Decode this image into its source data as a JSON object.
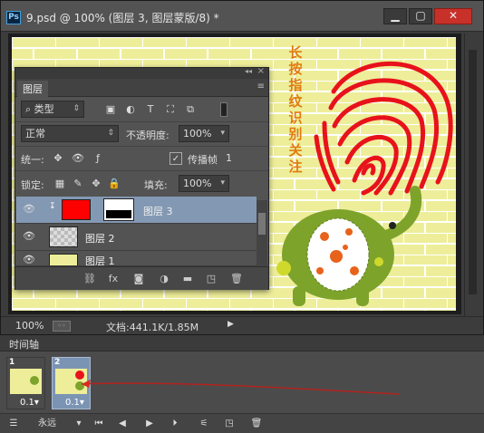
{
  "window": {
    "app_icon": "Ps",
    "title": "9.psd @ 100% (图层 3, 图层蒙版/8) *",
    "controls": [
      "minimize-icon",
      "maximize-icon",
      "close-icon"
    ]
  },
  "canvas_text": [
    "长",
    "按",
    "指",
    "纹",
    "识",
    "别",
    "关",
    "注"
  ],
  "colors": {
    "canvas_bg": "#eeee9a",
    "brick_line": "#ffffff",
    "fingerprint": "#e8121b",
    "text_orange": "#e07b10",
    "elephant": "#7ea32b"
  },
  "status": {
    "zoom": "100%",
    "doc_info": "文档:441.1K/1.85M"
  },
  "layers_panel": {
    "tab": "图层",
    "filter_kind": "类型",
    "blend_mode": "正常",
    "opacity_label": "不透明度:",
    "opacity_value": "100%",
    "unify_label": "统一:",
    "propagate_label": "传播帧",
    "propagate_value": "1",
    "lock_label": "锁定:",
    "fill_label": "填充:",
    "fill_value": "100%",
    "layers": [
      {
        "name": "图层 3",
        "active": true
      },
      {
        "name": "图层 2",
        "active": false
      },
      {
        "name": "图层 1",
        "active": false
      }
    ]
  },
  "timeline": {
    "tab": "时间轴",
    "frames": [
      {
        "num": "1",
        "delay": "0.1▾"
      },
      {
        "num": "2",
        "delay": "0.1▾"
      }
    ],
    "loop": "永远"
  }
}
